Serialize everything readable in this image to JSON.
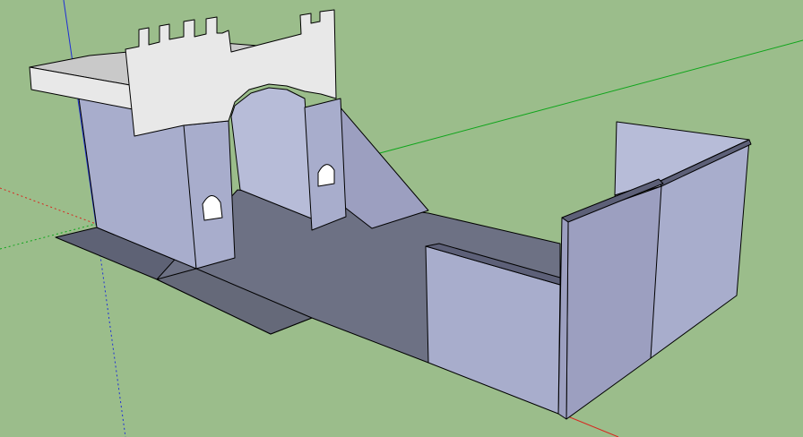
{
  "scene": {
    "background_color": "#9bbd8b",
    "axis_colors": {
      "red": "#d8261f",
      "green": "#0ea51a",
      "blue": "#1f2fd6"
    },
    "face_colors": {
      "wall_front": "#a8adcc",
      "wall_side": "#9c9fc0",
      "wall_top": "#5d6078",
      "wall_light": "#b7bcd8",
      "parapet": "#e8e8e8",
      "parapet_top": "#f7f7f7",
      "roof_top": "#c9c9c9",
      "floor": "#6d7184",
      "floor_dark": "#656979",
      "shadow": "#5e6275"
    }
  }
}
